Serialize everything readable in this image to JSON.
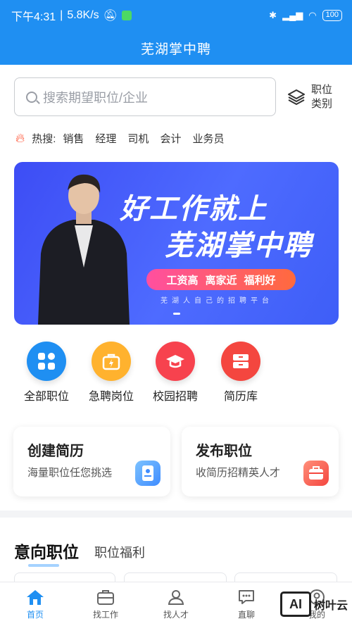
{
  "status": {
    "time": "下午4:31",
    "speed": "5.8K/s",
    "battery": "100"
  },
  "app_title": "芜湖掌中聘",
  "search": {
    "placeholder": "搜索期望职位/企业"
  },
  "job_type": {
    "line1": "职位",
    "line2": "类别"
  },
  "hot": {
    "label": "热搜:",
    "tags": [
      "销售",
      "经理",
      "司机",
      "会计",
      "业务员"
    ]
  },
  "banner": {
    "line1": "好工作就上",
    "line2": "芜湖掌中聘",
    "pill": [
      "工资高",
      "离家近",
      "福利好"
    ],
    "sub": "芜湖人自己的招聘平台"
  },
  "quick": [
    {
      "label": "全部职位",
      "color": "#1f8ff2",
      "icon": "grid-icon"
    },
    {
      "label": "急聘岗位",
      "color": "#ffb22e",
      "icon": "urgent-bag-icon"
    },
    {
      "label": "校园招聘",
      "color": "#f7424e",
      "icon": "graduation-cap-icon"
    },
    {
      "label": "简历库",
      "color": "#f4463f",
      "icon": "drawer-icon"
    }
  ],
  "cards": [
    {
      "title": "创建简历",
      "subtitle": "海量职位任您挑选",
      "color": "#5aa2ff",
      "icon": "resume-icon"
    },
    {
      "title": "发布职位",
      "subtitle": "收简历招精英人才",
      "color": "#ff6a5b",
      "icon": "briefcase-icon"
    }
  ],
  "section": {
    "active": "意向职位",
    "other": "职位福利"
  },
  "nav": [
    {
      "label": "首页",
      "icon": "home-icon",
      "active": true
    },
    {
      "label": "找工作",
      "icon": "briefcase-icon",
      "active": false
    },
    {
      "label": "找人才",
      "icon": "person-icon",
      "active": false
    },
    {
      "label": "直聊",
      "icon": "chat-icon",
      "active": false
    },
    {
      "label": "我的",
      "icon": "user-icon",
      "active": false
    }
  ],
  "watermark": {
    "box": "AI",
    "text": "树叶云"
  },
  "colors": {
    "primary": "#1f8ff2"
  }
}
